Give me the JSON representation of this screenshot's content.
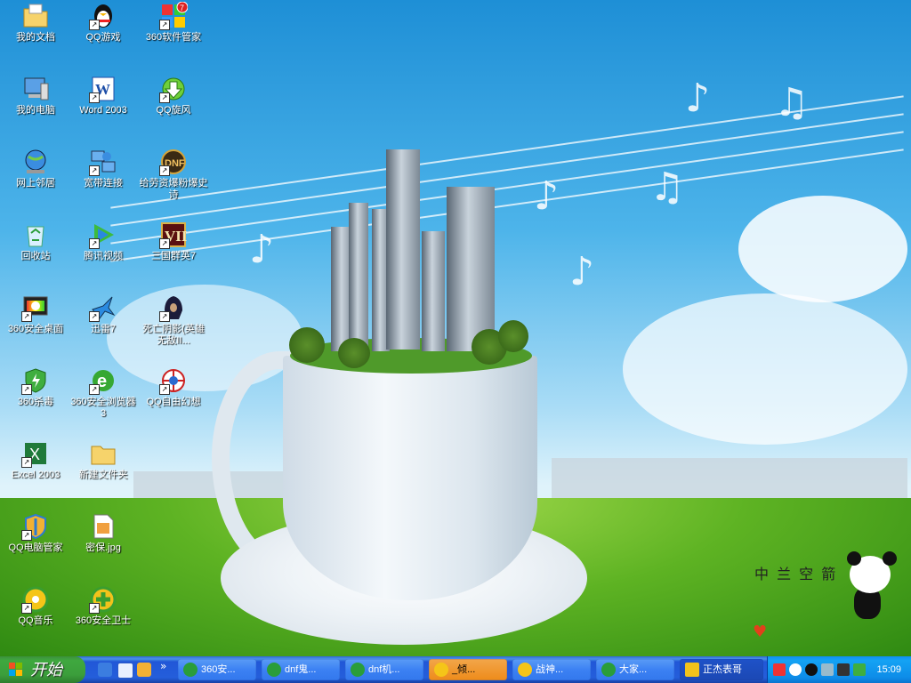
{
  "desktop": {
    "icons": [
      {
        "label": "我的文档"
      },
      {
        "label": "我的电脑"
      },
      {
        "label": "网上邻居"
      },
      {
        "label": "回收站"
      },
      {
        "label": "360安全桌面"
      },
      {
        "label": "360杀毒"
      },
      {
        "label": "Excel 2003"
      },
      {
        "label": "QQ电脑管家"
      },
      {
        "label": "QQ音乐"
      },
      {
        "label": "QQ游戏"
      },
      {
        "label": "Word 2003"
      },
      {
        "label": "宽带连接"
      },
      {
        "label": "腾讯视频"
      },
      {
        "label": "迅雷7"
      },
      {
        "label": "360安全浏览器 3"
      },
      {
        "label": "新建文件夹"
      },
      {
        "label": "密保.jpg"
      },
      {
        "label": "360安全卫士"
      },
      {
        "label": "360软件管家"
      },
      {
        "label": "QQ旋风"
      },
      {
        "label": "给劳资爆粉爆史诗"
      },
      {
        "label": "三国群英7"
      },
      {
        "label": "死亡阴影(英雄无敌II..."
      },
      {
        "label": "QQ自由幻想"
      }
    ],
    "wallpaper_text": "中 兰 空 箭"
  },
  "taskbar": {
    "start_label": "开始",
    "buttons": [
      {
        "label": "360安..."
      },
      {
        "label": "dnf鬼..."
      },
      {
        "label": "dnf机..."
      },
      {
        "label": "_倾..."
      },
      {
        "label": "战神..."
      },
      {
        "label": "大家..."
      },
      {
        "label": "正杰表哥"
      }
    ],
    "clock": "15:09"
  },
  "colors": {
    "taskbar_blue": "#245edb",
    "start_green": "#3b9e3b",
    "tray_blue": "#0f8ef2",
    "active_orange": "#ee8b1a"
  }
}
